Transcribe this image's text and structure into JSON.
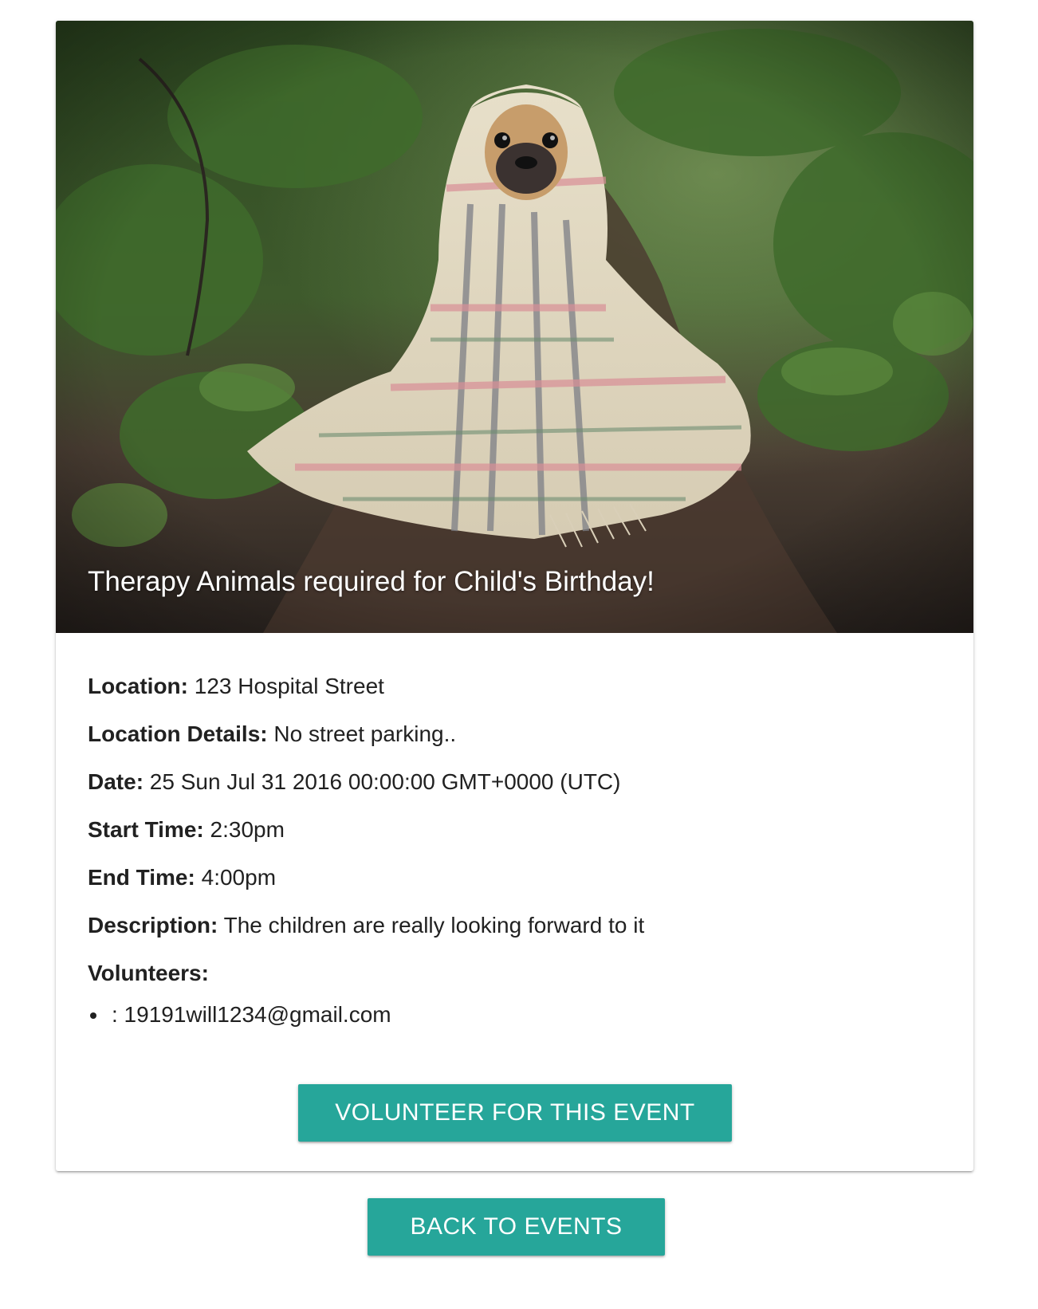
{
  "event": {
    "title": "Therapy Animals required for Child's Birthday!",
    "image_alt": "pug wrapped in plaid blanket on forest path",
    "details": [
      {
        "label": "Location:",
        "value": " 123 Hospital Street"
      },
      {
        "label": "Location Details:",
        "value": " No street parking.."
      },
      {
        "label": "Date:",
        "value": " 25 Sun Jul 31 2016 00:00:00 GMT+0000 (UTC)"
      },
      {
        "label": "Start Time:",
        "value": " 2:30pm"
      },
      {
        "label": "End Time:",
        "value": " 4:00pm"
      },
      {
        "label": "Description:",
        "value": " The children are really looking forward to it"
      }
    ],
    "volunteers_label": "Volunteers:",
    "volunteers": [
      ": 19191will1234@gmail.com"
    ]
  },
  "actions": {
    "volunteer_label": "VOLUNTEER FOR THIS EVENT",
    "back_label": "BACK TO EVENTS"
  },
  "colors": {
    "button": "#26a69a",
    "text": "#212121"
  }
}
